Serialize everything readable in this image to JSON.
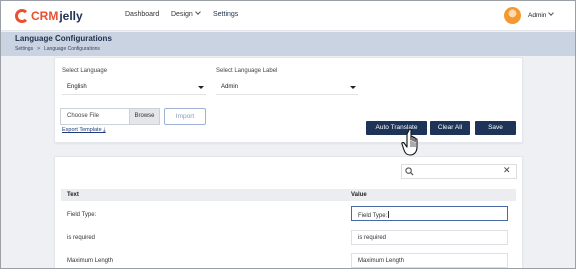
{
  "header": {
    "logo": {
      "crm": "CRM",
      "jelly": "jelly"
    },
    "nav": [
      {
        "label": "Dashboard"
      },
      {
        "label": "Design"
      },
      {
        "label": "Settings"
      }
    ],
    "user": {
      "name": "Admin"
    }
  },
  "page": {
    "title": "Language Configurations",
    "breadcrumb": [
      "Settings",
      ">",
      "Language Configurations"
    ]
  },
  "form": {
    "select_language_label": "Select Language",
    "select_language_value": "English",
    "select_label_label": "Select Language Label",
    "select_label_value": "Admin",
    "choose_file": "Choose File",
    "browse": "Browse",
    "import": "Import",
    "export_template": "Export Template ⤓"
  },
  "actions": {
    "auto_translate": "Auto Translate",
    "clear_all": "Clear All",
    "save": "Save"
  },
  "table": {
    "search_value": "",
    "columns": [
      "Text",
      "Value"
    ],
    "rows": [
      {
        "text": "Field Type:",
        "value": "Field Type:"
      },
      {
        "text": "is required",
        "value": "is required"
      },
      {
        "text": "Maximum Length",
        "value": "Maximum Length"
      }
    ]
  },
  "colors": {
    "primary": "#1e3358",
    "accent": "#e8502f",
    "band": "#c9d3e2"
  }
}
